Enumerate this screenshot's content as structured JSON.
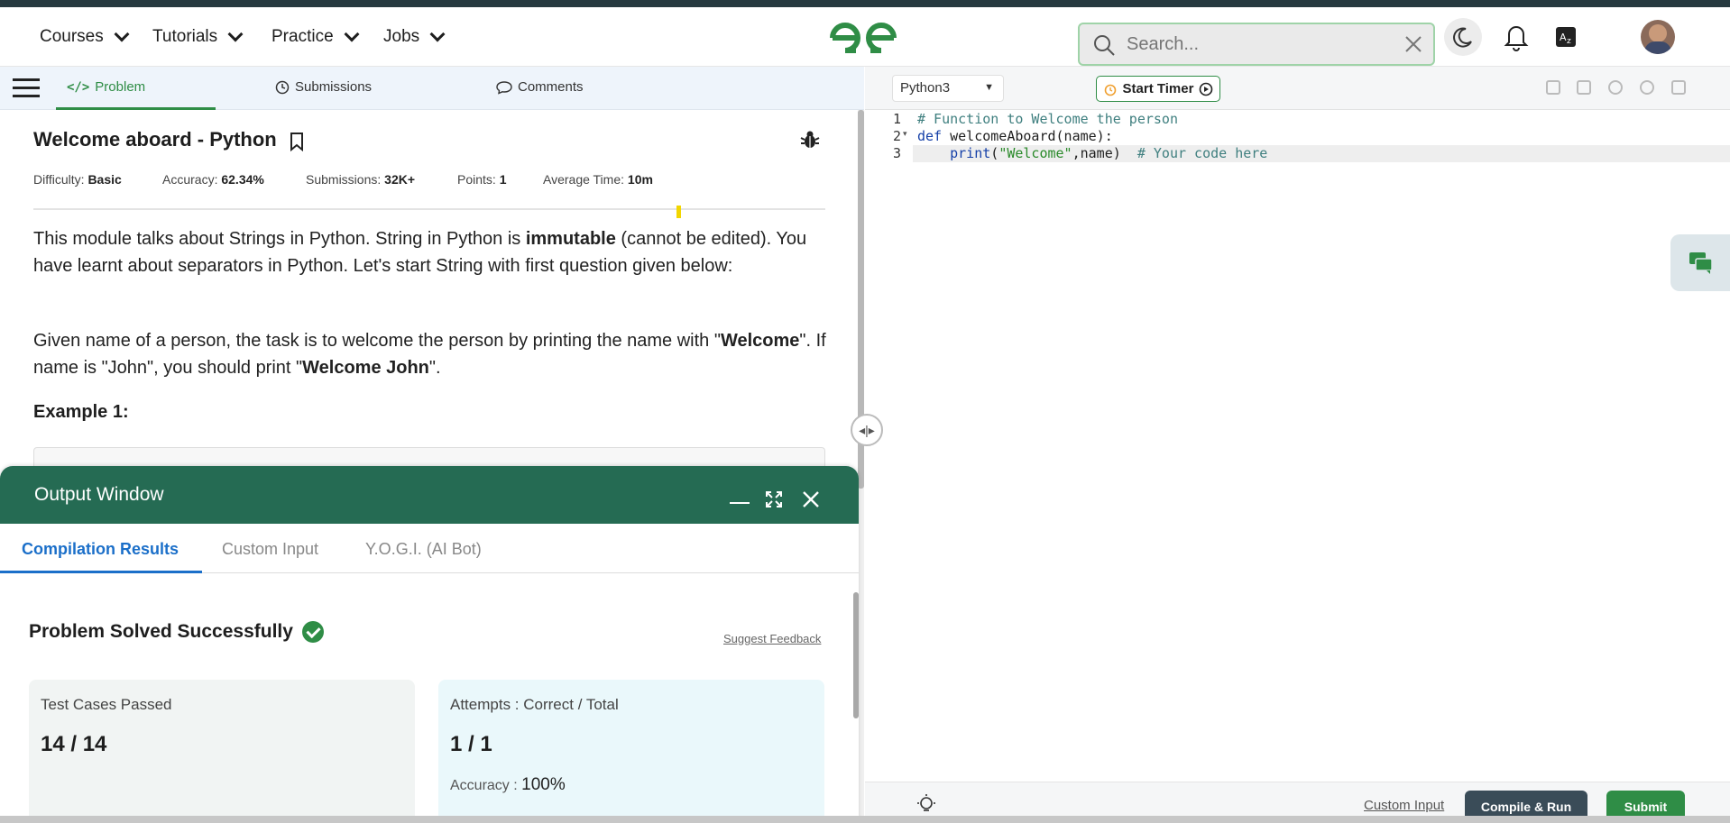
{
  "nav": {
    "items": [
      "Courses",
      "Tutorials",
      "Practice",
      "Jobs"
    ],
    "search_placeholder": "Search...",
    "logo": "gfg-logo"
  },
  "problem_tabs": [
    {
      "label": "Problem",
      "icon": "code-icon",
      "active": true
    },
    {
      "label": "Submissions",
      "icon": "clock-icon",
      "active": false
    },
    {
      "label": "Comments",
      "icon": "comment-icon",
      "active": false
    }
  ],
  "problem": {
    "title": "Welcome aboard - Python",
    "meta": [
      {
        "label": "Difficulty:",
        "value": "Basic"
      },
      {
        "label": "Accuracy:",
        "value": "62.34%"
      },
      {
        "label": "Submissions:",
        "value": "32K+"
      },
      {
        "label": "Points:",
        "value": "1"
      },
      {
        "label": "Average Time:",
        "value": "10m"
      }
    ],
    "para1_a": "This module talks about Strings in Python. String in Python is ",
    "para1_b": "immutable",
    "para1_c": " (cannot be edited). You have learnt about separators in Python. Let's start String with first question given below:",
    "para2_a": "Given name of a person, the task is to welcome the person by printing the name with \"",
    "para2_b": "Welcome",
    "para2_c": "\". If name is \"John\", you should print \"",
    "para2_d": "Welcome John",
    "para2_e": "\".",
    "example_heading": "Example 1:"
  },
  "output": {
    "title": "Output Window",
    "tabs": [
      "Compilation Results",
      "Custom Input",
      "Y.O.G.I. (AI Bot)"
    ],
    "status": "Problem Solved Successfully",
    "suggest": "Suggest Feedback",
    "card1_label": "Test Cases Passed",
    "card1_value": "14 / 14",
    "card2_label": "Attempts : Correct / Total",
    "card2_value": "1 / 1",
    "accuracy_label": "Accuracy :",
    "accuracy_value": "100%"
  },
  "editor": {
    "language": "Python3",
    "timer": "Start Timer",
    "lines": [
      "1",
      "2",
      "3"
    ],
    "line1": "# Function to Welcome the person",
    "line2_kw": "def",
    "line2_rest": " welcomeAboard(name):",
    "line3_indent": "    ",
    "line3_fn": "print",
    "line3_paren": "(",
    "line3_str": "\"Welcome\"",
    "line3_rest": ",name)  ",
    "line3_comment": "# Your code here"
  },
  "footer": {
    "custom_input": "Custom Input",
    "compile": "Compile & Run",
    "submit": "Submit"
  },
  "colors": {
    "brand_green": "#2f8d46",
    "output_header": "#256b53",
    "accent_blue": "#1b6fc9"
  }
}
